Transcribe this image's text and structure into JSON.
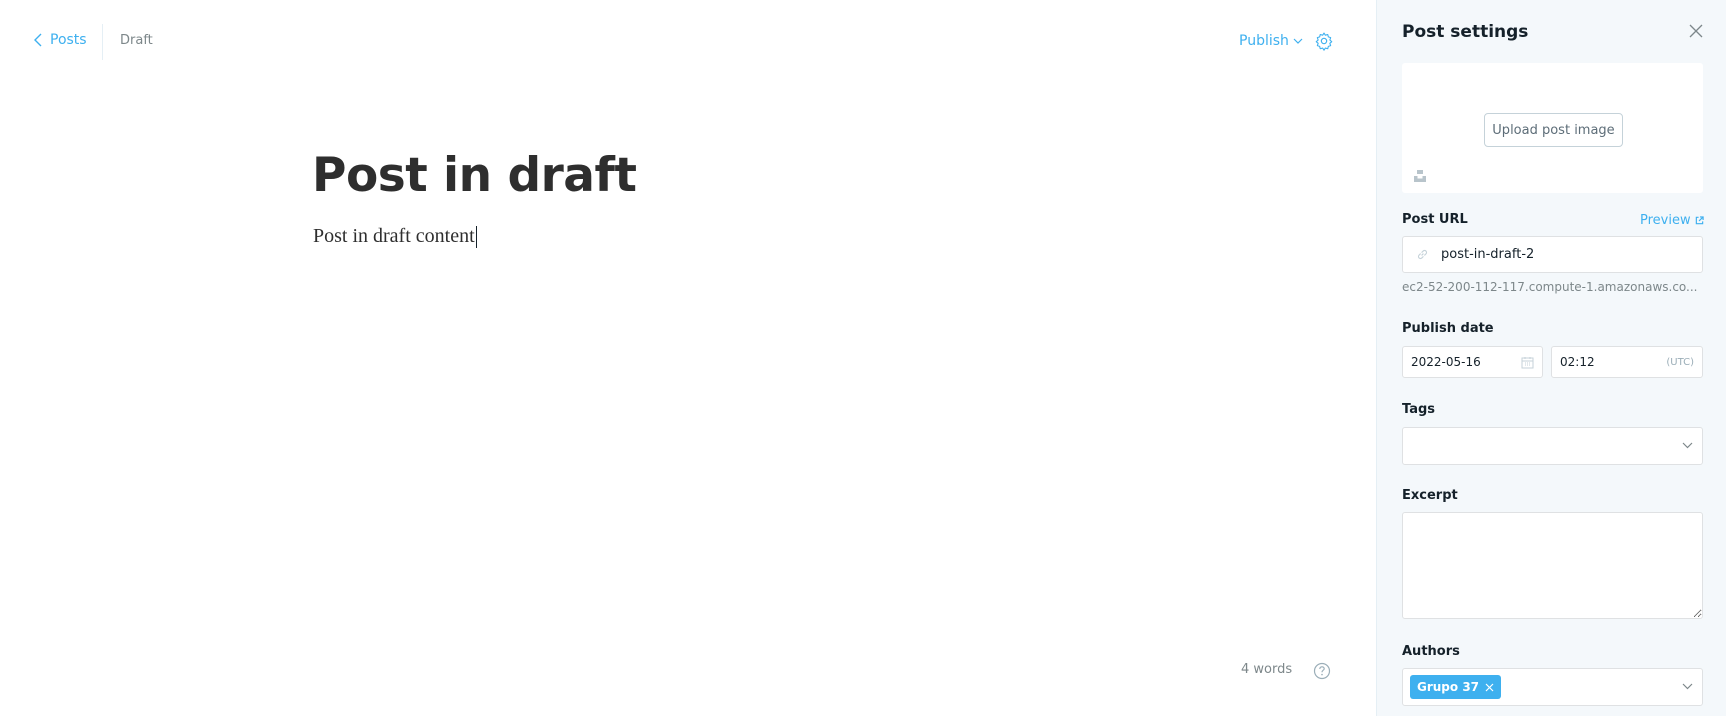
{
  "header": {
    "back_label": "Posts",
    "status": "Draft",
    "publish_label": "Publish"
  },
  "post": {
    "title": "Post in draft",
    "content": "Post in draft content"
  },
  "footer": {
    "word_count": "4 words"
  },
  "settings": {
    "title": "Post settings",
    "upload_image_label": "Upload post image",
    "post_url": {
      "label": "Post URL",
      "preview_label": "Preview",
      "slug": "post-in-draft-2",
      "full_url": "ec2-52-200-112-117.compute-1.amazonaws.co..."
    },
    "publish_date": {
      "label": "Publish date",
      "date": "2022-05-16",
      "time": "02:12",
      "timezone": "(UTC)"
    },
    "tags": {
      "label": "Tags"
    },
    "excerpt": {
      "label": "Excerpt",
      "value": ""
    },
    "authors": {
      "label": "Authors",
      "items": [
        "Grupo 37"
      ]
    }
  },
  "colors": {
    "accent": "#3eb0ef",
    "text_dark": "#15212a",
    "panel_bg": "#f4f8fb"
  },
  "icons": [
    "chevron-left-icon",
    "chevron-down-icon",
    "gear-icon",
    "close-icon",
    "unsplash-icon",
    "external-link-icon",
    "link-icon",
    "calendar-icon",
    "help-icon",
    "remove-icon"
  ]
}
